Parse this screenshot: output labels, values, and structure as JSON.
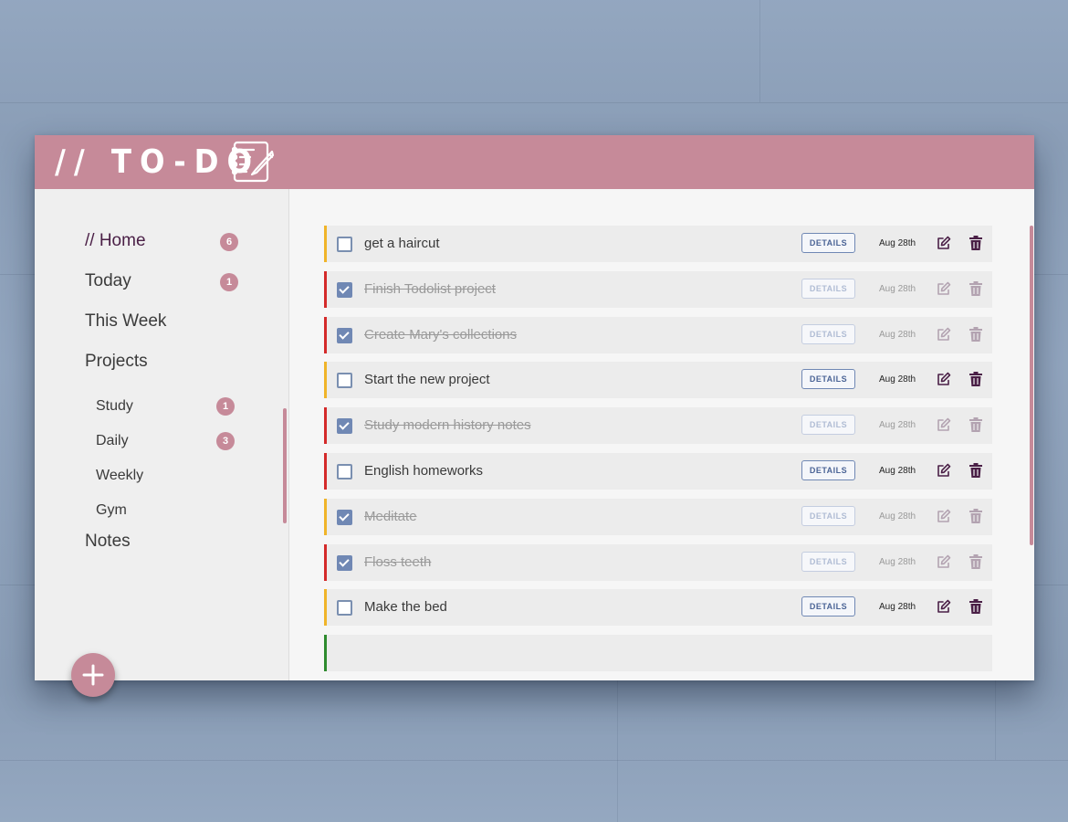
{
  "app": {
    "title": "// TO-DO",
    "logo_icon": "notebook-pen-icon"
  },
  "colors": {
    "accent": "#c68a99",
    "nav_active": "#4a1f46",
    "priority_high": "#d42a2a",
    "priority_medium": "#f0b429",
    "priority_low": "#2e8b2e",
    "link": "#7088b4"
  },
  "sidebar": {
    "nav": [
      {
        "label": "// Home",
        "count": "6"
      },
      {
        "label": "Today",
        "count": "1"
      },
      {
        "label": "This Week"
      },
      {
        "label": "Projects"
      }
    ],
    "projects": [
      {
        "label": "Study",
        "count": "1"
      },
      {
        "label": "Daily",
        "count": "3"
      },
      {
        "label": "Weekly"
      },
      {
        "label": "Gym"
      }
    ],
    "notes_label": "Notes",
    "add_button_icon": "plus-icon"
  },
  "tasks": [
    {
      "title": "get a haircut",
      "done": false,
      "priority": "medium",
      "details_label": "DETAILS",
      "date": "Aug 28th"
    },
    {
      "title": "Finish Todolist project",
      "done": true,
      "priority": "high",
      "details_label": "DETAILS",
      "date": "Aug 28th"
    },
    {
      "title": "Create Mary's collections",
      "done": true,
      "priority": "high",
      "details_label": "DETAILS",
      "date": "Aug 28th"
    },
    {
      "title": "Start the new project",
      "done": false,
      "priority": "medium",
      "details_label": "DETAILS",
      "date": "Aug 28th"
    },
    {
      "title": "Study modern history notes",
      "done": true,
      "priority": "high",
      "details_label": "DETAILS",
      "date": "Aug 28th"
    },
    {
      "title": "English homeworks",
      "done": false,
      "priority": "high",
      "details_label": "DETAILS",
      "date": "Aug 28th"
    },
    {
      "title": "Meditate",
      "done": true,
      "priority": "medium",
      "details_label": "DETAILS",
      "date": "Aug 28th"
    },
    {
      "title": "Floss teeth",
      "done": true,
      "priority": "high",
      "details_label": "DETAILS",
      "date": "Aug 28th"
    },
    {
      "title": "Make the bed",
      "done": false,
      "priority": "medium",
      "details_label": "DETAILS",
      "date": "Aug 28th"
    }
  ],
  "task_icons": {
    "edit": "edit-icon",
    "delete": "trash-icon"
  }
}
